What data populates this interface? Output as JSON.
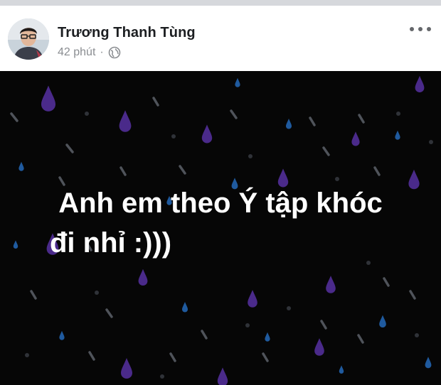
{
  "post": {
    "author_name": "Trương Thanh Tùng",
    "timestamp": "42 phút",
    "separator": "·",
    "privacy_icon": "globe-icon",
    "more_icon": "more-horizontal-icon",
    "image_text_line1": "Anh em theo Ý tập khóc",
    "image_text_line2": "đi nhỉ :)))"
  },
  "colors": {
    "image_background": "#060606",
    "drop_purple": "#4a2a8a",
    "drop_blue": "#1f5a9e",
    "drop_grey": "#5b5f66"
  }
}
